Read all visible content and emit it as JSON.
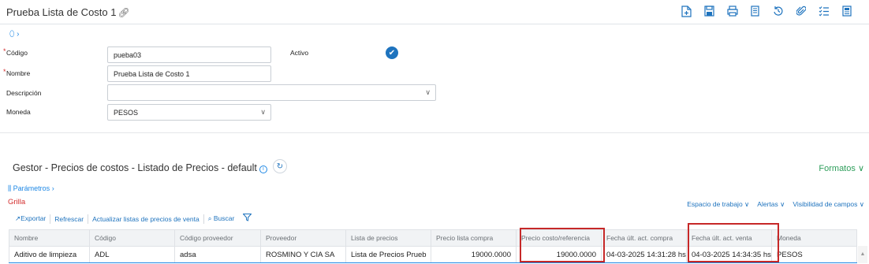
{
  "header": {
    "title": "Prueba Lista de Costo 1",
    "toolbar_icons": [
      "new-doc-icon",
      "save-icon",
      "print-icon",
      "copy-icon",
      "history-icon",
      "attach-icon",
      "checklist-icon",
      "report-icon"
    ]
  },
  "form": {
    "codigo_label": "Código",
    "codigo_value": "pueba03",
    "activo_label": "Activo",
    "activo_checked": true,
    "nombre_label": "Nombre",
    "nombre_value": "Prueba Lista de Costo 1",
    "descripcion_label": "Descripción",
    "descripcion_value": "",
    "moneda_label": "Moneda",
    "moneda_value": "PESOS",
    "required_mark": "*"
  },
  "section": {
    "title": "Gestor - Precios de costos - Listado de Precios - default",
    "formatos_label": "Formatos",
    "parametros_label": "Parámetros",
    "grilla_label": "Grilla",
    "espacio_label": "Espacio de trabajo",
    "alertas_label": "Alertas",
    "visibilidad_label": "Visibilidad de campos",
    "exportar_label": "Exportar",
    "refrescar_label": "Refrescar",
    "actualizar_label": "Actualizar listas de precios de venta",
    "buscar_label": "Buscar"
  },
  "table": {
    "columns": [
      "Nombre",
      "Código",
      "Código proveedor",
      "Proveedor",
      "Lista de precios",
      "Precio lista compra",
      "Precio costo/referencia",
      "Fecha últ. act. compra",
      "Fecha últ. act. venta",
      "Moneda"
    ],
    "rows": [
      [
        "Aditivo de limpieza",
        "ADL",
        "adsa",
        "ROSMINO Y CIA SA",
        "Lista de Precios Prueb",
        "19000.0000",
        "19000.0000",
        "04-03-2025 14:31:28 hs",
        "04-03-2025 14:34:35 hs",
        "PESOS"
      ]
    ]
  },
  "colors": {
    "accent": "#1e73be",
    "formatos": "#2e9e5b",
    "required": "#d32f2f",
    "highlight_box": "#c62828"
  }
}
